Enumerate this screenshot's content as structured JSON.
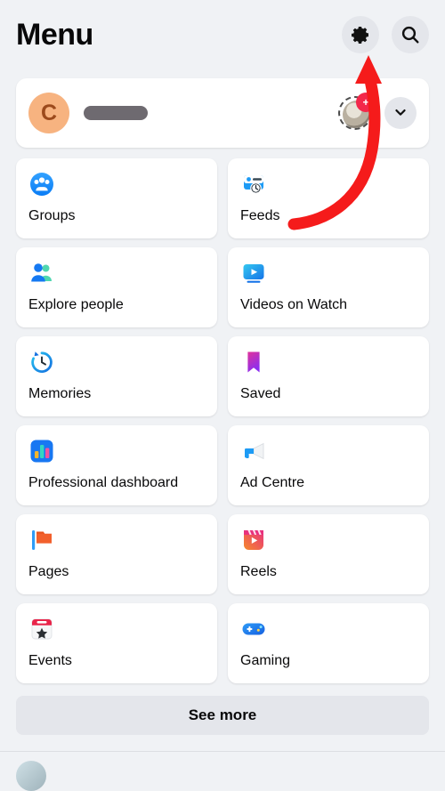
{
  "header": {
    "title": "Menu",
    "settings_icon": "gear-icon",
    "search_icon": "search-icon"
  },
  "profile": {
    "avatar_letter": "C",
    "name_redacted": true,
    "story_badge_label": "+",
    "story_icon": "story-avatar",
    "expand_icon": "chevron-down-icon"
  },
  "menu": {
    "tiles": [
      {
        "label": "Groups",
        "icon": "groups-icon"
      },
      {
        "label": "Feeds",
        "icon": "feeds-icon"
      },
      {
        "label": "Explore people",
        "icon": "explore-people-icon"
      },
      {
        "label": "Videos on Watch",
        "icon": "videos-on-watch-icon"
      },
      {
        "label": "Memories",
        "icon": "memories-icon"
      },
      {
        "label": "Saved",
        "icon": "saved-icon"
      },
      {
        "label": "Professional dashboard",
        "icon": "professional-dashboard-icon"
      },
      {
        "label": "Ad Centre",
        "icon": "ad-centre-icon"
      },
      {
        "label": "Pages",
        "icon": "pages-icon"
      },
      {
        "label": "Reels",
        "icon": "reels-icon"
      },
      {
        "label": "Events",
        "icon": "events-icon"
      },
      {
        "label": "Gaming",
        "icon": "gaming-icon"
      }
    ],
    "see_more_label": "See more"
  },
  "annotation": {
    "arrow_color": "#f51b1b",
    "arrow_target": "gear-icon"
  },
  "colors": {
    "background": "#f0f2f5",
    "card": "#ffffff",
    "chip": "#e4e6eb",
    "text": "#080809",
    "avatar_bg": "#f7b380",
    "badge_red": "#f3284a"
  }
}
